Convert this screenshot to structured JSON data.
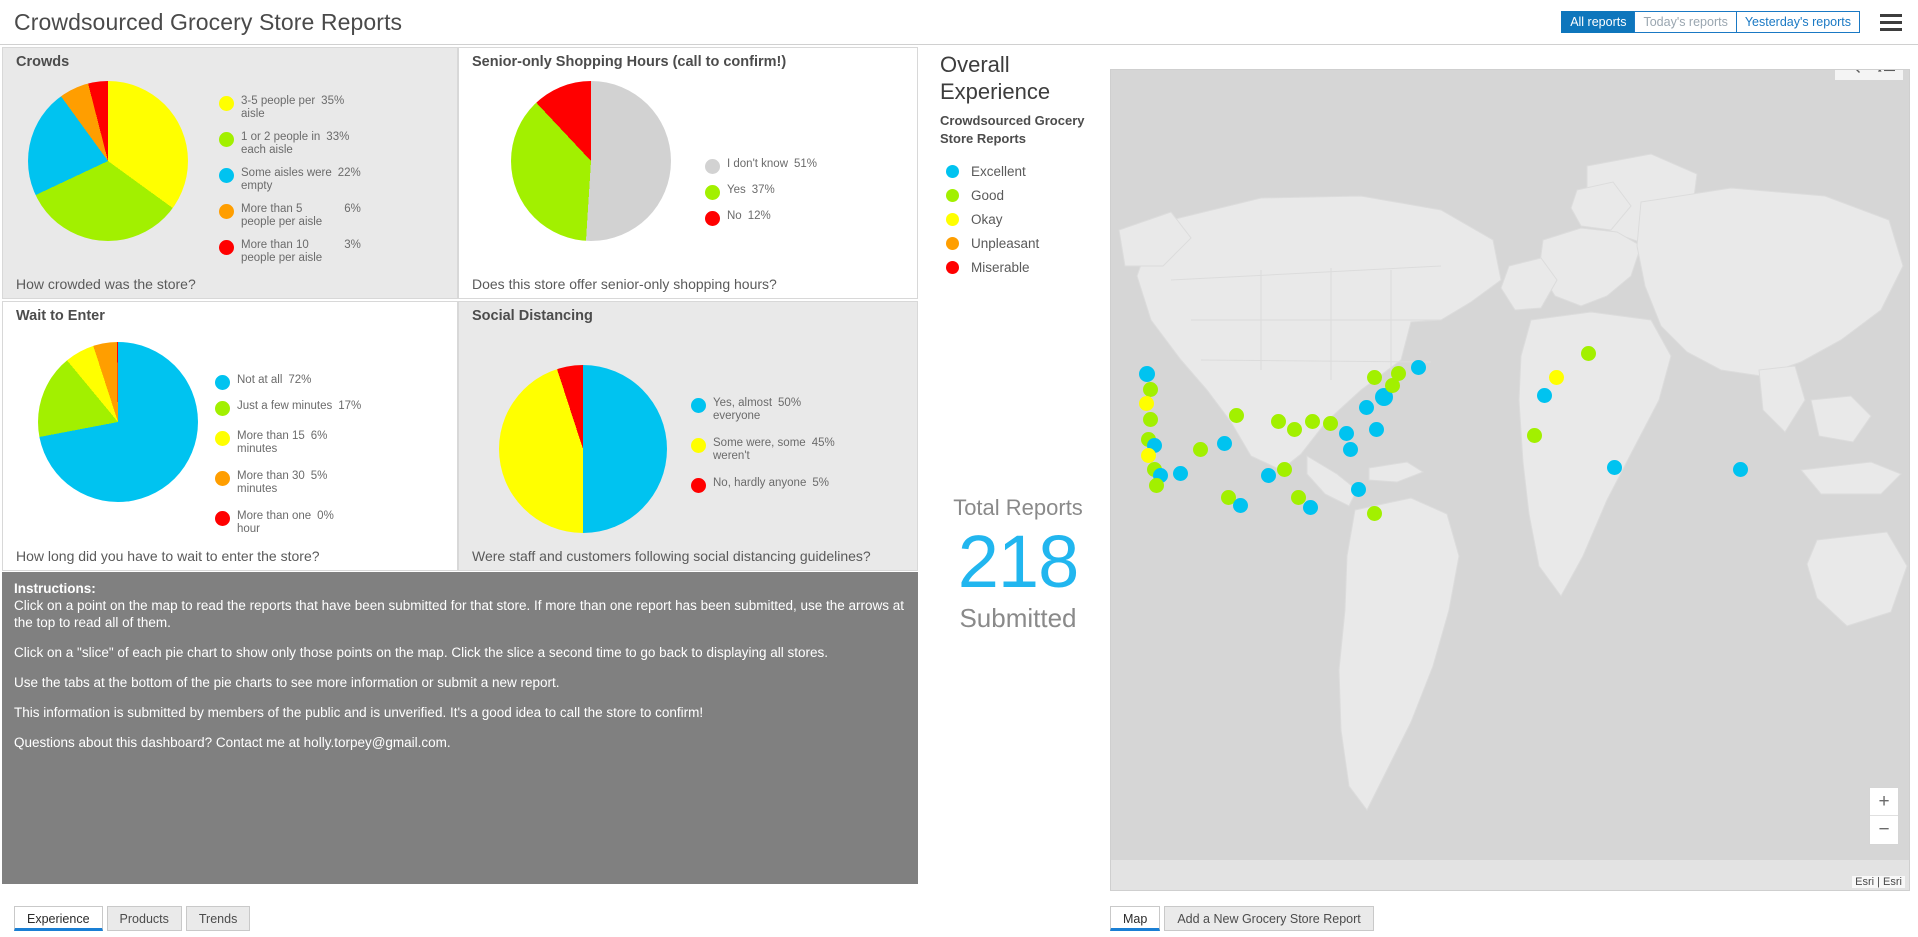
{
  "header": {
    "title": "Crowdsourced Grocery Store Reports",
    "filters": [
      {
        "label": "All reports",
        "active": true
      },
      {
        "label": "Today's reports",
        "active": false
      },
      {
        "label": "Yesterday's reports",
        "active": false
      }
    ],
    "menu_icon": "hamburger-menu-icon"
  },
  "colors": {
    "cyan": "#00c3f0",
    "green": "#a2f000",
    "yellow": "#ffff00",
    "orange": "#ff9e00",
    "red": "#ff0000",
    "gray": "#d2d2d2",
    "accent_blue": "#0e76bc",
    "counter_blue": "#21b6ef"
  },
  "chart_data": [
    {
      "type": "pie",
      "title": "Crowds",
      "question": "How crowded was the store?",
      "categories": [
        "3-5 people per aisle",
        "1 or 2 people in each aisle",
        "Some aisles were empty",
        "More than 5 people per aisle",
        "More than 10 people per aisle"
      ],
      "values": [
        35,
        33,
        22,
        6,
        3
      ],
      "labels": [
        "35%",
        "33%",
        "22%",
        "6%",
        "3%"
      ],
      "colors": [
        "#ffff00",
        "#a2f000",
        "#00c3f0",
        "#ff9e00",
        "#ff0000"
      ],
      "legend": "right"
    },
    {
      "type": "pie",
      "title": "Senior-only Shopping Hours (call to confirm!)",
      "question": "Does this store offer senior-only shopping hours?",
      "categories": [
        "I don't know",
        "Yes",
        "No"
      ],
      "values": [
        51,
        37,
        12
      ],
      "labels": [
        "51%",
        "37%",
        "12%"
      ],
      "colors": [
        "#d2d2d2",
        "#a2f000",
        "#ff0000"
      ],
      "legend": "right"
    },
    {
      "type": "pie",
      "title": "Wait to Enter",
      "question": "How long did you have to wait to enter the store?",
      "categories": [
        "Not at all",
        "Just a few minutes",
        "More than 15 minutes",
        "More than 30 minutes",
        "More than one hour"
      ],
      "values": [
        72,
        17,
        6,
        5,
        0
      ],
      "labels": [
        "72%",
        "17%",
        "6%",
        "5%",
        "0%"
      ],
      "colors": [
        "#00c3f0",
        "#a2f000",
        "#ffff00",
        "#ff9e00",
        "#ff0000"
      ],
      "legend": "right"
    },
    {
      "type": "pie",
      "title": "Social Distancing",
      "question": "Were staff and customers following social distancing guidelines?",
      "categories": [
        "Yes, almost everyone",
        "Some were, some weren't",
        "No, hardly anyone"
      ],
      "values": [
        50,
        45,
        5
      ],
      "labels": [
        "50%",
        "45%",
        "5%"
      ],
      "colors": [
        "#00c3f0",
        "#ffff00",
        "#ff0000"
      ],
      "legend": "right"
    }
  ],
  "panels": {
    "crowds": {
      "title": "Crowds",
      "question": "How crowded was the store?",
      "legend": [
        {
          "label": "3-5 people per aisle",
          "label_line1": "3-5 people per",
          "label_line2": "aisle",
          "pct": "35%",
          "color": "#ffff00"
        },
        {
          "label": "1 or 2 people in each aisle",
          "label_line1": "1 or 2 people in",
          "label_line2": "each aisle",
          "pct": "33%",
          "color": "#a2f000"
        },
        {
          "label": "Some aisles were empty",
          "label_line1": "Some aisles were",
          "label_line2": "empty",
          "pct": "22%",
          "color": "#00c3f0"
        },
        {
          "label": "More than 5 people per aisle",
          "label_line1": "More than 5",
          "label_line2": "people per aisle",
          "pct": "6%",
          "color": "#ff9e00"
        },
        {
          "label": "More than 10 people per aisle",
          "label_line1": "More than 10",
          "label_line2": "people per aisle",
          "pct": "3%",
          "color": "#ff0000"
        }
      ]
    },
    "senior": {
      "title": "Senior-only Shopping Hours (call to confirm!)",
      "question": "Does this store offer senior-only shopping hours?",
      "legend": [
        {
          "label_line1": "I don't know",
          "label_line2": "",
          "pct": "51%",
          "color": "#d2d2d2"
        },
        {
          "label_line1": "Yes",
          "label_line2": "",
          "pct": "37%",
          "color": "#a2f000"
        },
        {
          "label_line1": "No",
          "label_line2": "",
          "pct": "12%",
          "color": "#ff0000"
        }
      ]
    },
    "wait": {
      "title": "Wait to Enter",
      "question": "How long did you have to wait to enter the store?",
      "legend": [
        {
          "label_line1": "Not at all",
          "label_line2": "",
          "pct": "72%",
          "color": "#00c3f0"
        },
        {
          "label_line1": "Just a few minutes",
          "label_line2": "",
          "pct": "17%",
          "color": "#a2f000"
        },
        {
          "label_line1": "More than 15",
          "label_line2": "minutes",
          "pct": "6%",
          "color": "#ffff00"
        },
        {
          "label_line1": "More than 30",
          "label_line2": "minutes",
          "pct": "5%",
          "color": "#ff9e00"
        },
        {
          "label_line1": "More than one",
          "label_line2": "hour",
          "pct": "0%",
          "color": "#ff0000"
        }
      ]
    },
    "distancing": {
      "title": "Social Distancing",
      "question": "Were staff and customers following social distancing guidelines?",
      "legend": [
        {
          "label_line1": "Yes, almost",
          "label_line2": "everyone",
          "pct": "50%",
          "color": "#00c3f0"
        },
        {
          "label_line1": "Some were, some",
          "label_line2": "weren't",
          "pct": "45%",
          "color": "#ffff00"
        },
        {
          "label_line1": "No, hardly anyone",
          "label_line2": "",
          "pct": "5%",
          "color": "#ff0000"
        }
      ]
    }
  },
  "instructions": {
    "heading": "Instructions:",
    "paragraphs": [
      "Click on a point on the map to read the reports that have been submitted for that store. If more than one report has been submitted, use the arrows at the top to read all of them.",
      "Click on a \"slice\" of each pie chart to show only those points on the map. Click the slice a second time to go back to displaying all stores.",
      "Use the tabs at the bottom of the pie charts to see more information or submit a new report.",
      "This information is submitted by members of the public and is unverified. It's a good idea to call the store to confirm!",
      "Questions about this dashboard? Contact me at holly.torpey@gmail.com."
    ]
  },
  "left_tabs": [
    {
      "label": "Experience",
      "active": true
    },
    {
      "label": "Products",
      "active": false
    },
    {
      "label": "Trends",
      "active": false
    }
  ],
  "experience": {
    "title_line1": "Overall",
    "title_line2": "Experience",
    "subtitle_line1": "Crowdsourced Grocery",
    "subtitle_line2": "Store Reports",
    "legend": [
      {
        "label": "Excellent",
        "color": "#00c3f0"
      },
      {
        "label": "Good",
        "color": "#a2f000"
      },
      {
        "label": "Okay",
        "color": "#ffff00"
      },
      {
        "label": "Unpleasant",
        "color": "#ff9e00"
      },
      {
        "label": "Miserable",
        "color": "#ff0000"
      }
    ],
    "total_label": "Total Reports",
    "total_value": "218",
    "total_sub": "Submitted"
  },
  "map": {
    "tools": [
      {
        "name": "search-icon",
        "title": "Search"
      },
      {
        "name": "legend-list-icon",
        "title": "Legend"
      }
    ],
    "zoom_in": "+",
    "zoom_out": "−",
    "attribution": "Esri | Esri",
    "tabs": [
      {
        "label": "Map",
        "active": true
      },
      {
        "label": "Add a New Grocery Store Report",
        "active": false
      }
    ]
  }
}
